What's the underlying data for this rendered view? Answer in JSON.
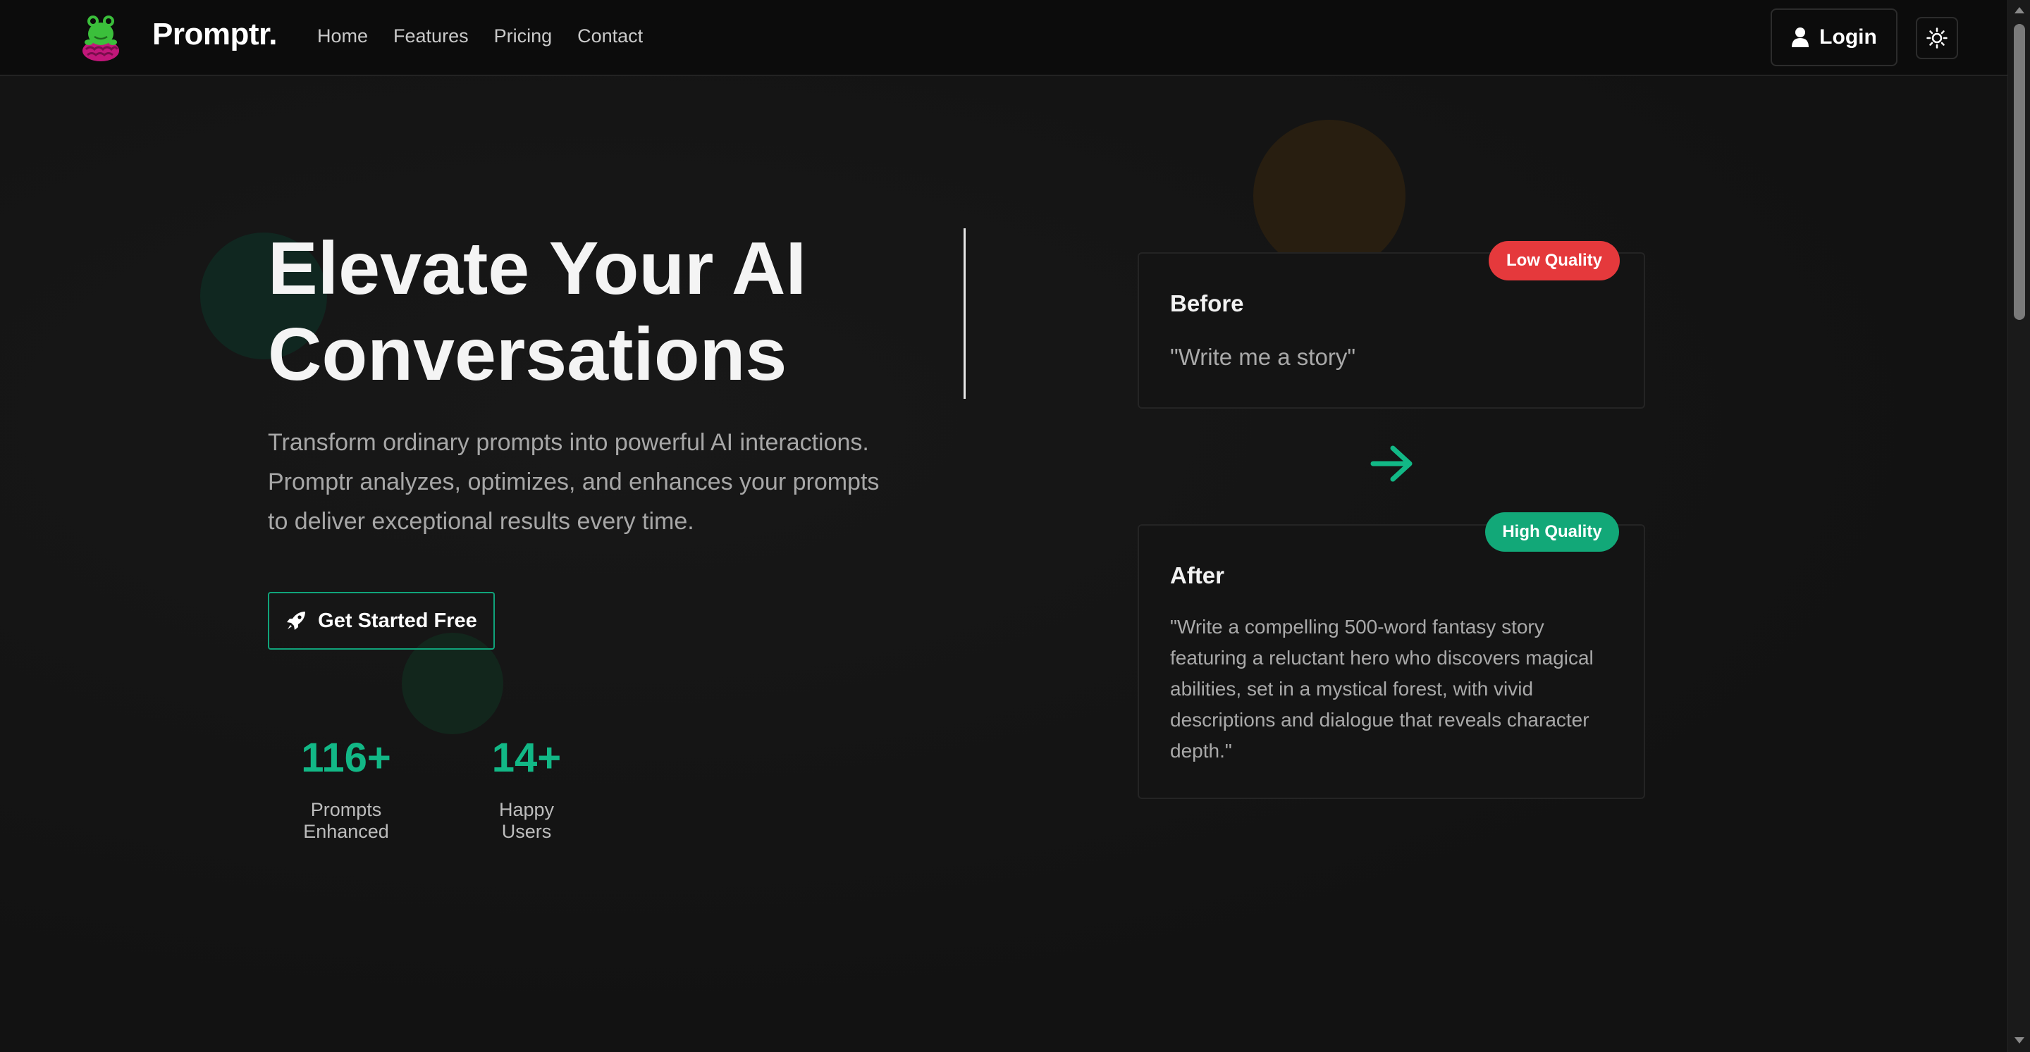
{
  "header": {
    "brand": "Promptr.",
    "nav": [
      "Home",
      "Features",
      "Pricing",
      "Contact"
    ],
    "login_label": "Login",
    "icons": {
      "user": "user-icon",
      "theme": "sun-icon",
      "logo": "frog-brain-logo"
    }
  },
  "hero": {
    "title_line1": "Elevate Your AI",
    "title_line2": "Conversations",
    "subtitle": "Transform ordinary prompts into powerful AI interactions. Promptr analyzes, optimizes, and enhances your prompts to deliver exceptional results every time.",
    "cta_label": "Get Started Free",
    "cta_icon": "rocket-icon",
    "stats": [
      {
        "value": "116+",
        "label": "Prompts Enhanced"
      },
      {
        "value": "14+",
        "label": "Happy Users"
      }
    ]
  },
  "comparison": {
    "before": {
      "badge": "Low Quality",
      "title": "Before",
      "text": "\"Write me a story\""
    },
    "after": {
      "badge": "High Quality",
      "title": "After",
      "text": "\"Write a compelling 500-word fantasy story featuring a reluctant hero who discovers magical abilities, set in a mystical forest, with vivid descriptions and dialogue that reveals character depth.\""
    },
    "arrow_icon": "arrow-right-icon"
  },
  "colors": {
    "accent": "#12b886",
    "low_badge": "#e5393c",
    "high_badge": "#12a878",
    "background": "#131313"
  }
}
